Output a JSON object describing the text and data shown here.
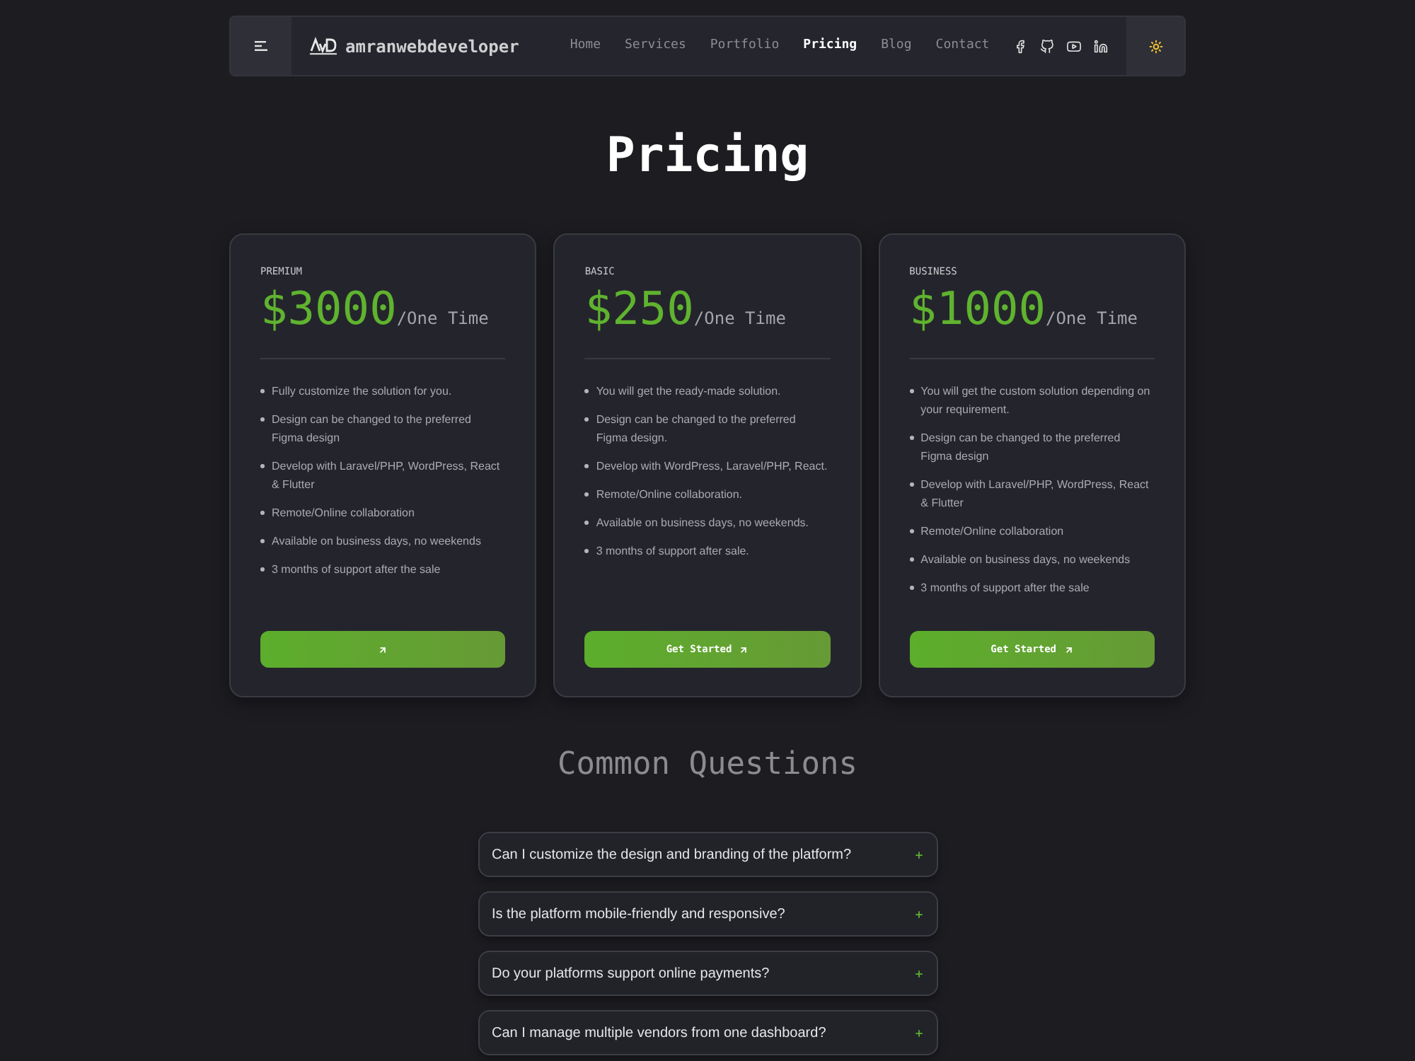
{
  "nav": {
    "brand": "amranwebdeveloper",
    "links": [
      {
        "label": "Home",
        "selected": false
      },
      {
        "label": "Services",
        "selected": false
      },
      {
        "label": "Portfolio",
        "selected": false
      },
      {
        "label": "Pricing",
        "selected": true
      },
      {
        "label": "Blog",
        "selected": false
      },
      {
        "label": "Contact",
        "selected": false
      }
    ]
  },
  "title": "Pricing",
  "plans": [
    {
      "name": "PREMIUM",
      "price": "$3000",
      "period": "/One Time",
      "features": [
        "Fully customize the solution for you.",
        "Design can be changed to the preferred Figma design",
        "Develop with Laravel/PHP, WordPress, React & Flutter",
        "Remote/Online collaboration",
        "Available on business days, no weekends",
        "3 months of support after the sale"
      ]
    },
    {
      "name": "BASIC",
      "price": "$250",
      "period": "/One Time",
      "features": [
        "You will get the ready-made solution.",
        "Design can be changed to the preferred Figma design.",
        "Develop with WordPress, Laravel/PHP, React.",
        "Remote/Online collaboration.",
        "Available on business days, no weekends.",
        "3 months of support after sale."
      ],
      "button": "Get Started"
    },
    {
      "name": "BUSINESS",
      "price": "$1000",
      "period": "/One Time",
      "features": [
        "You will get the custom solution depending on your requirement.",
        "Design can be changed to the preferred Figma design",
        "Develop with Laravel/PHP, WordPress, React & Flutter",
        "Remote/Online collaboration",
        "Available on business days, no weekends",
        "3 months of support after the sale"
      ],
      "button": "Get Started"
    }
  ],
  "faq": {
    "title": "Common Questions",
    "items": [
      {
        "question": "Can I customize the design and branding of the platform?",
        "expanded": false
      },
      {
        "question": "Is the platform mobile-friendly and responsive?",
        "expanded": false
      },
      {
        "question": "Do your platforms support online payments?",
        "expanded": false
      },
      {
        "question": "Can I manage multiple vendors from one dashboard?",
        "expanded": false
      }
    ]
  }
}
